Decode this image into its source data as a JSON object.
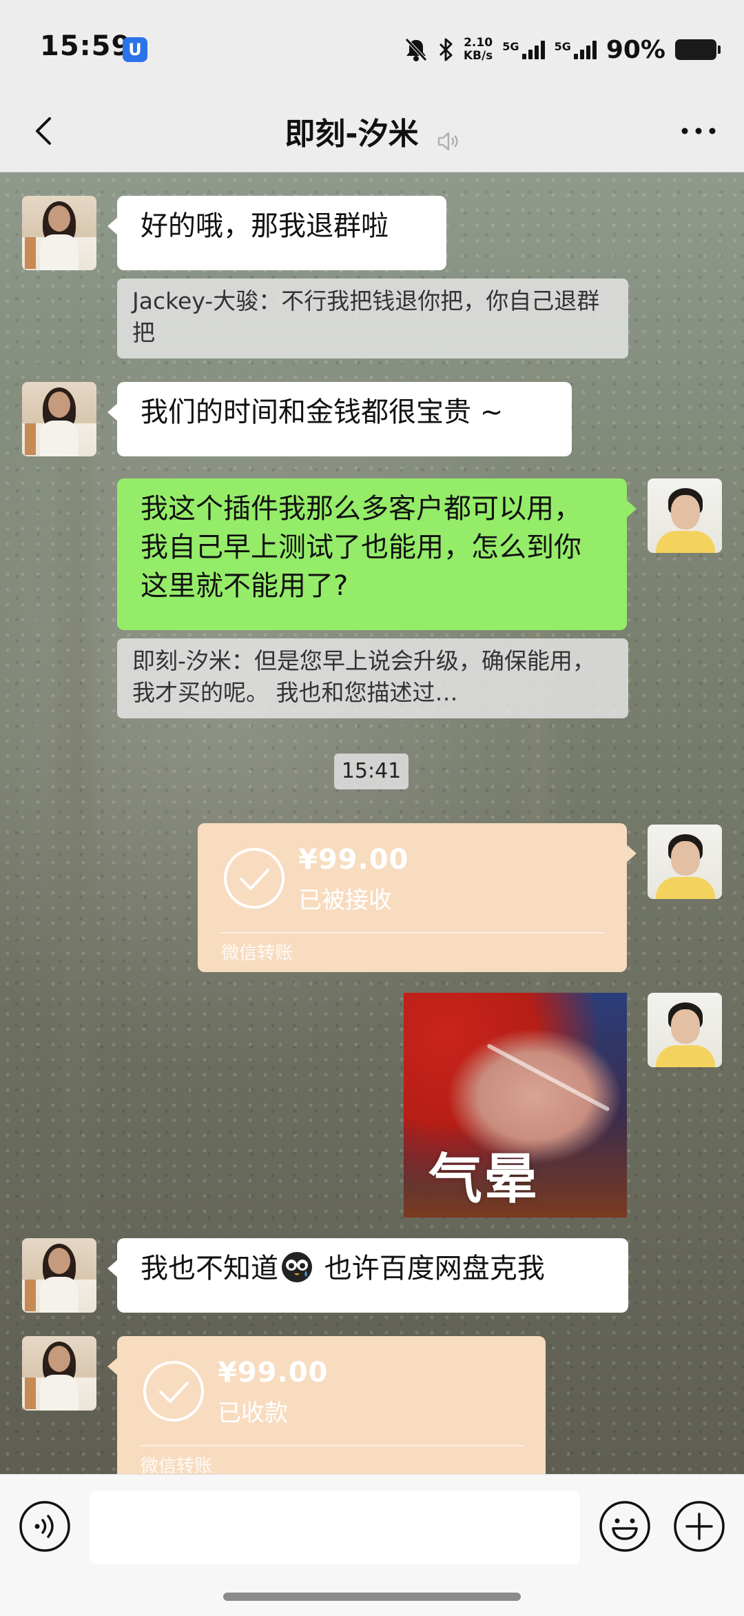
{
  "status_bar": {
    "time": "15:59",
    "app_badge": "U",
    "net_speed_value": "2.10",
    "net_speed_unit": "KB/s",
    "signal_1_label": "5G",
    "signal_2_label": "5G",
    "battery_percent": "90%",
    "icons": [
      "mute-icon",
      "bluetooth-icon"
    ]
  },
  "header": {
    "title": "即刻-汐米",
    "icons": [
      "back-icon",
      "mute-icon",
      "more-icon"
    ]
  },
  "messages": {
    "m1_text": "好的哦，那我退群啦",
    "q1_text": "Jackey-大骏：不行我把钱退你把，你自己退群把",
    "m2_text": "我们的时间和金钱都很宝贵 ~",
    "m3_text": "我这个插件我那么多客户都可以用，我自己早上测试了也能用，怎么到你这里就不能用了?",
    "q2_text": "即刻-汐米：但是您早上说会升级，确保能用，我才买的呢。 我也和您描述过…",
    "timestamp": "15:41",
    "transfer1": {
      "amount": "¥99.00",
      "status": "已被接收",
      "label": "微信转账"
    },
    "sticker_caption": "气晕",
    "m4_text_a": "我也不知道",
    "m4_text_b": " 也许百度网盘克我",
    "transfer2": {
      "amount": "¥99.00",
      "status": "已收款",
      "label": "微信转账"
    }
  },
  "input_bar": {
    "placeholder": "",
    "icons": [
      "voice-icon",
      "emoji-icon",
      "plus-icon"
    ]
  },
  "colors": {
    "green_bubble": "#95ec69",
    "transfer_bubble": "#f8dcc0",
    "bar_bg": "#ededed"
  }
}
